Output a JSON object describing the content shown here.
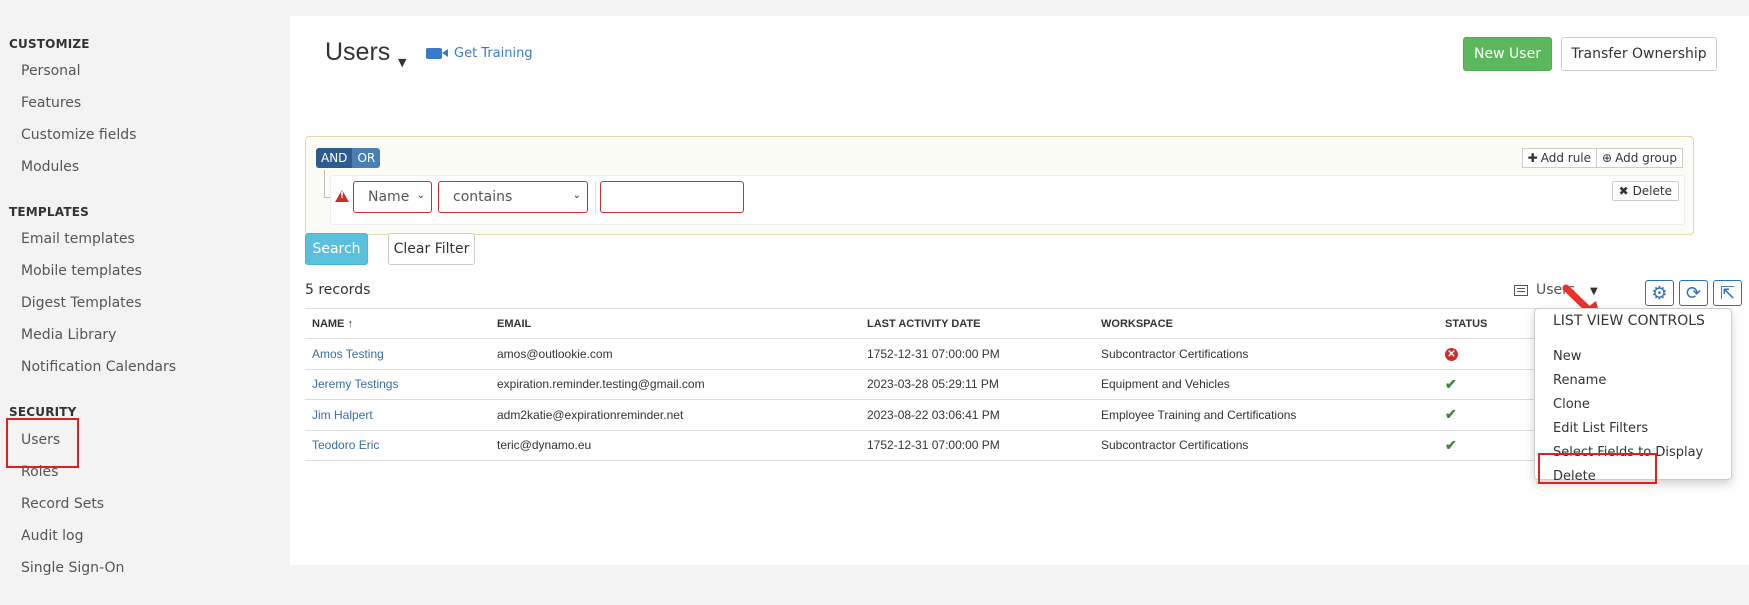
{
  "sidebar": {
    "sections": [
      {
        "title": "CUSTOMIZE",
        "items": [
          "Personal",
          "Features",
          "Customize fields",
          "Modules"
        ]
      },
      {
        "title": "TEMPLATES",
        "items": [
          "Email templates",
          "Mobile templates",
          "Digest Templates",
          "Media Library",
          "Notification Calendars"
        ]
      },
      {
        "title": "SECURITY",
        "items": [
          "Users",
          "Roles",
          "Record Sets",
          "Audit log",
          "Single Sign-On"
        ]
      }
    ]
  },
  "header": {
    "title": "Users",
    "training_label": "Get Training",
    "new_user_label": "New User",
    "transfer_label": "Transfer Ownership"
  },
  "query_builder": {
    "and_label": "AND",
    "or_label": "OR",
    "add_rule_label": "Add rule",
    "add_group_label": "Add group",
    "delete_label": "Delete",
    "field_value": "Name",
    "operator_value": "contains",
    "value_input": ""
  },
  "actions": {
    "search_label": "Search",
    "clear_label": "Clear Filter"
  },
  "list": {
    "record_count": "5 records",
    "view_label": "Users",
    "columns": [
      "NAME",
      "EMAIL",
      "LAST ACTIVITY DATE",
      "WORKSPACE",
      "STATUS"
    ],
    "sort_indicator": "↑",
    "rows": [
      {
        "name": "Amos Testing",
        "email": "amos@outlookie.com",
        "last_activity": "1752-12-31 07:00:00 PM",
        "workspace": "Subcontractor Certifications",
        "status": "inactive"
      },
      {
        "name": "Jeremy Testings",
        "email": "expiration.reminder.testing@gmail.com",
        "last_activity": "2023-03-28 05:29:11 PM",
        "workspace": "Equipment and Vehicles",
        "status": "active"
      },
      {
        "name": "Jim Halpert",
        "email": "adm2katie@expirationreminder.net",
        "last_activity": "2023-08-22 03:06:41 PM",
        "workspace": "Employee Training and Certifications",
        "status": "active"
      },
      {
        "name": "Teodoro Eric",
        "email": "teric@dynamo.eu",
        "last_activity": "1752-12-31 07:00:00 PM",
        "workspace": "Subcontractor Certifications",
        "status": "active"
      }
    ]
  },
  "dropdown": {
    "header": "LIST VIEW CONTROLS",
    "items": [
      "New",
      "Rename",
      "Clone",
      "Edit List Filters",
      "Select Fields to Display",
      "Delete"
    ]
  },
  "colors": {
    "accent": "#3a7bc8",
    "success": "#5cb85c",
    "info": "#5bc0de",
    "danger": "#c9302c",
    "highlight": "#e02020"
  }
}
